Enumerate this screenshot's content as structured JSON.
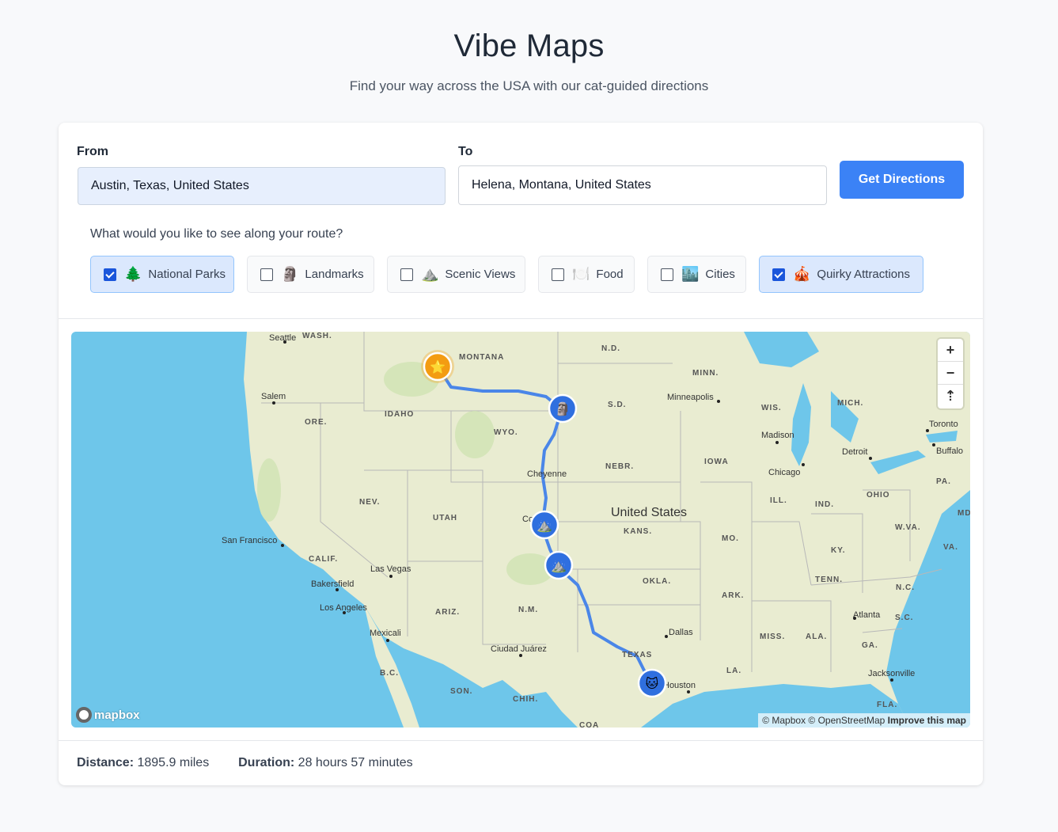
{
  "header": {
    "title": "Vibe Maps",
    "subtitle": "Find your way across the USA with our cat-guided directions"
  },
  "form": {
    "from_label": "From",
    "from_value": "Austin, Texas, United States",
    "to_label": "To",
    "to_value": "Helena, Montana, United States",
    "submit_label": "Get Directions",
    "question": "What would you like to see along your route?"
  },
  "filters": [
    {
      "label": "National Parks",
      "icon": "🌲",
      "checked": true
    },
    {
      "label": "Landmarks",
      "icon": "🗿",
      "checked": false
    },
    {
      "label": "Scenic Views",
      "icon": "⛰️",
      "checked": false
    },
    {
      "label": "Food",
      "icon": "🍽️",
      "checked": false
    },
    {
      "label": "Cities",
      "icon": "🏙️",
      "checked": false
    },
    {
      "label": "Quirky Attractions",
      "icon": "🎪",
      "checked": true
    }
  ],
  "map": {
    "controls": {
      "zoom_in": "+",
      "zoom_out": "−",
      "compass": "⇡"
    },
    "logo": "mapbox",
    "attribution": "© Mapbox © OpenStreetMap",
    "improve": "Improve this map",
    "labels": {
      "country": "United States",
      "states": [
        "WASH.",
        "MONTANA",
        "N.D.",
        "MINN.",
        "S.D.",
        "WIS.",
        "MICH.",
        "ORE.",
        "IDAHO",
        "WYO.",
        "IOWA",
        "NEBR.",
        "NEV.",
        "UTAH",
        "ILL.",
        "IND.",
        "OHIO",
        "PA.",
        "CALIF.",
        "KANS.",
        "MO.",
        "W.VA.",
        "VA.",
        "KY.",
        "OKLA.",
        "TENN.",
        "ARK.",
        "N.C.",
        "ARIZ.",
        "N.M.",
        "S.C.",
        "MISS.",
        "ALA.",
        "GA.",
        "TEXAS",
        "LA.",
        "B.C.",
        "SON.",
        "CHIH.",
        "FLA.",
        "MD",
        "COA"
      ],
      "cities": [
        "Seattle",
        "Salem",
        "Minneapolis",
        "Madison",
        "Toronto",
        "Detroit",
        "Buffalo",
        "Chicago",
        "Cheyenne",
        "San Francisco",
        "Las Vegas",
        "Bakersfield",
        "Los Angeles",
        "Mexicali",
        "Ciudad Juárez",
        "Dallas",
        "Atlanta",
        "Jacksonville",
        "Houston",
        "Co"
      ]
    },
    "markers": [
      {
        "type": "start-star",
        "icon": "⭐"
      },
      {
        "type": "landmark",
        "icon": "🗿"
      },
      {
        "type": "scenic",
        "icon": "⛰️"
      },
      {
        "type": "scenic",
        "icon": "⛰️"
      },
      {
        "type": "end-cat",
        "icon": "🐱"
      }
    ],
    "colors": {
      "water": "#6ec6ea",
      "land": "#e9ecd1",
      "route": "#4a86e8",
      "marker": "#2f6fdf",
      "star": "#f39c12"
    }
  },
  "stats": {
    "distance_label": "Distance:",
    "distance_value": "1895.9 miles",
    "duration_label": "Duration:",
    "duration_value": "28 hours 57 minutes"
  }
}
